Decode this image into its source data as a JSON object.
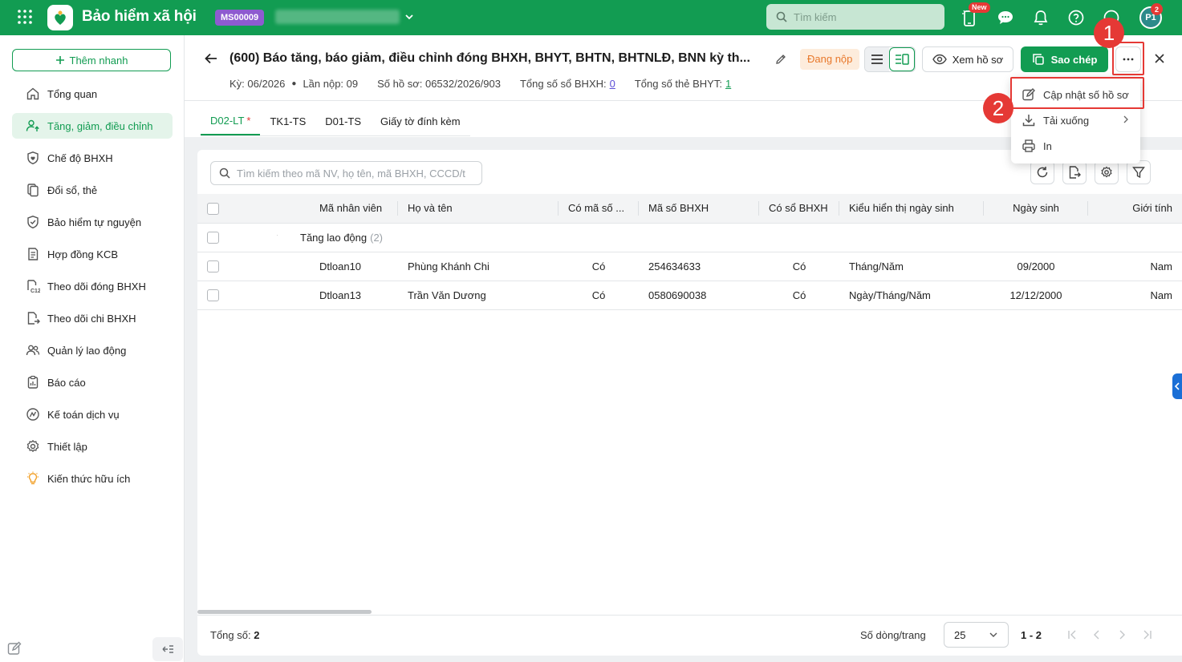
{
  "app": {
    "title": "Bảo hiểm xã hội",
    "company_code": "MS00009",
    "search_placeholder": "Tìm kiếm",
    "new_badge": "New",
    "avatar_initials": "P1",
    "notification_count": "2",
    "brand_color": "#129c52"
  },
  "sidebar": {
    "quick_add": "Thêm nhanh",
    "items": [
      {
        "label": "Tổng quan",
        "icon": "home-icon"
      },
      {
        "label": "Tăng, giảm, điều chỉnh",
        "icon": "user-up-icon",
        "active": true
      },
      {
        "label": "Chế độ BHXH",
        "icon": "shield-heart-icon"
      },
      {
        "label": "Đổi sổ, thẻ",
        "icon": "card-swap-icon"
      },
      {
        "label": "Bảo hiểm tự nguyện",
        "icon": "shield-check-icon"
      },
      {
        "label": "Hợp đồng KCB",
        "icon": "contract-icon"
      },
      {
        "label": "Theo dõi đóng BHXH",
        "icon": "c12-icon"
      },
      {
        "label": "Theo dõi chi BHXH",
        "icon": "document-out-icon"
      },
      {
        "label": "Quản lý lao động",
        "icon": "users-icon"
      },
      {
        "label": "Báo cáo",
        "icon": "report-icon"
      },
      {
        "label": "Kế toán dịch vụ",
        "icon": "accounting-icon"
      },
      {
        "label": "Thiết lập",
        "icon": "gear-icon"
      },
      {
        "label": "Kiến thức hữu ích",
        "icon": "lightbulb-icon"
      }
    ]
  },
  "header": {
    "title": "(600) Báo tăng, báo giảm, điều chỉnh đóng BHXH, BHYT, BHTN, BHTNLĐ, BNN kỳ th...",
    "status": "Đang nộp",
    "view_button": "Xem hồ sơ",
    "copy_button": "Sao chép",
    "meta": {
      "period": "Kỳ: 06/2026",
      "submission": "Lần nộp: 09",
      "record_no": "Số hồ sơ: 06532/2026/903",
      "total_bhxh_label": "Tổng số sổ BHXH:",
      "total_bhxh_value": "0",
      "total_bhyt_label": "Tổng số thẻ BHYT:",
      "total_bhyt_value": "1"
    }
  },
  "tabs": [
    {
      "label": "D02-LT",
      "required": "*",
      "active": true
    },
    {
      "label": "TK1-TS"
    },
    {
      "label": "D01-TS"
    },
    {
      "label": "Giấy tờ đính kèm"
    }
  ],
  "table": {
    "search_placeholder": "Tìm kiếm theo mã NV, họ tên, mã BHXH, CCCD/t",
    "columns": [
      "Mã nhân viên",
      "Họ và tên",
      "Có mã số ...",
      "Mã số BHXH",
      "Có sổ BHXH",
      "Kiểu hiển thị ngày sinh",
      "Ngày sinh",
      "Giới tính"
    ],
    "group": {
      "label": "Tăng lao động",
      "count": "(2)"
    },
    "rows": [
      [
        "Dtloan10",
        "Phùng Khánh Chi",
        "Có",
        "254634633",
        "Có",
        "Tháng/Năm",
        "09/2000",
        "Nam"
      ],
      [
        "Dtloan13",
        "Trần Văn Dương",
        "Có",
        "0580690038",
        "Có",
        "Ngày/Tháng/Năm",
        "12/12/2000",
        "Nam"
      ]
    ]
  },
  "footer": {
    "total_label": "Tổng số:",
    "total_value": "2",
    "rows_per_page_label": "Số dòng/trang",
    "rows_per_page": "25",
    "range": "1 - 2"
  },
  "menu": {
    "items": [
      {
        "label": "Cập nhật số hồ sơ",
        "icon": "edit-icon"
      },
      {
        "label": "Tải xuống",
        "icon": "download-icon"
      },
      {
        "label": "In",
        "icon": "printer-icon"
      }
    ]
  },
  "annotations": {
    "step1": "1",
    "step2": "2",
    "highlight_color": "#e53935"
  }
}
